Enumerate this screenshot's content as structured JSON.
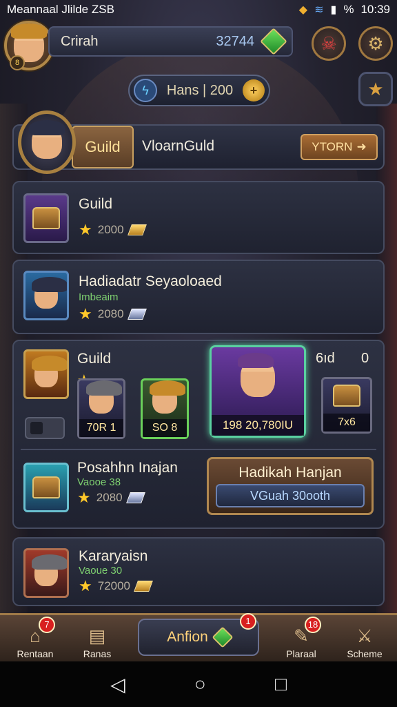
{
  "status_bar": {
    "left_text": "Meannaal Jlilde ZSB",
    "battery_pct": "%",
    "time": "10:39"
  },
  "player": {
    "name": "Crirah",
    "currency": "32744",
    "avatar_level": "8"
  },
  "energy_pill": {
    "label": "Hans | 200"
  },
  "guild_header": {
    "tab_label": "Guild",
    "guild_name": "VloarnGuld",
    "join_label": "YTORN"
  },
  "cards": [
    {
      "title": "Guild",
      "subtitle": "",
      "value": "2000"
    },
    {
      "title": "Hadiadatr Seyaoloaed",
      "subtitle": "Imbeaim",
      "value": "2080"
    }
  ],
  "heroes_panel": {
    "title": "Guild",
    "side_label": "6ıd",
    "side_count": "0",
    "heroes": [
      {
        "caption": "70R 1"
      },
      {
        "caption": "SO 8"
      },
      {
        "caption": "198 20,780IU"
      },
      {
        "caption": "7x6"
      }
    ],
    "sub_item": {
      "title": "Posahhn Inajan",
      "subtitle": "Vaooe 38",
      "value": "2080"
    },
    "promo": {
      "title": "Hadikah Hanjan",
      "button": "VGuah 30ooth"
    }
  },
  "last_card": {
    "title": "Kararyaisn",
    "subtitle": "Vaoue 30",
    "value": "72000"
  },
  "bottom_nav": {
    "items": [
      {
        "label": "Rentaan",
        "badge": "7"
      },
      {
        "label": "Ranas",
        "badge": ""
      },
      {
        "label": "Plaraal",
        "badge": "18"
      },
      {
        "label": "Scheme",
        "badge": ""
      }
    ],
    "action_label": "Anfion",
    "action_badge": "1"
  }
}
